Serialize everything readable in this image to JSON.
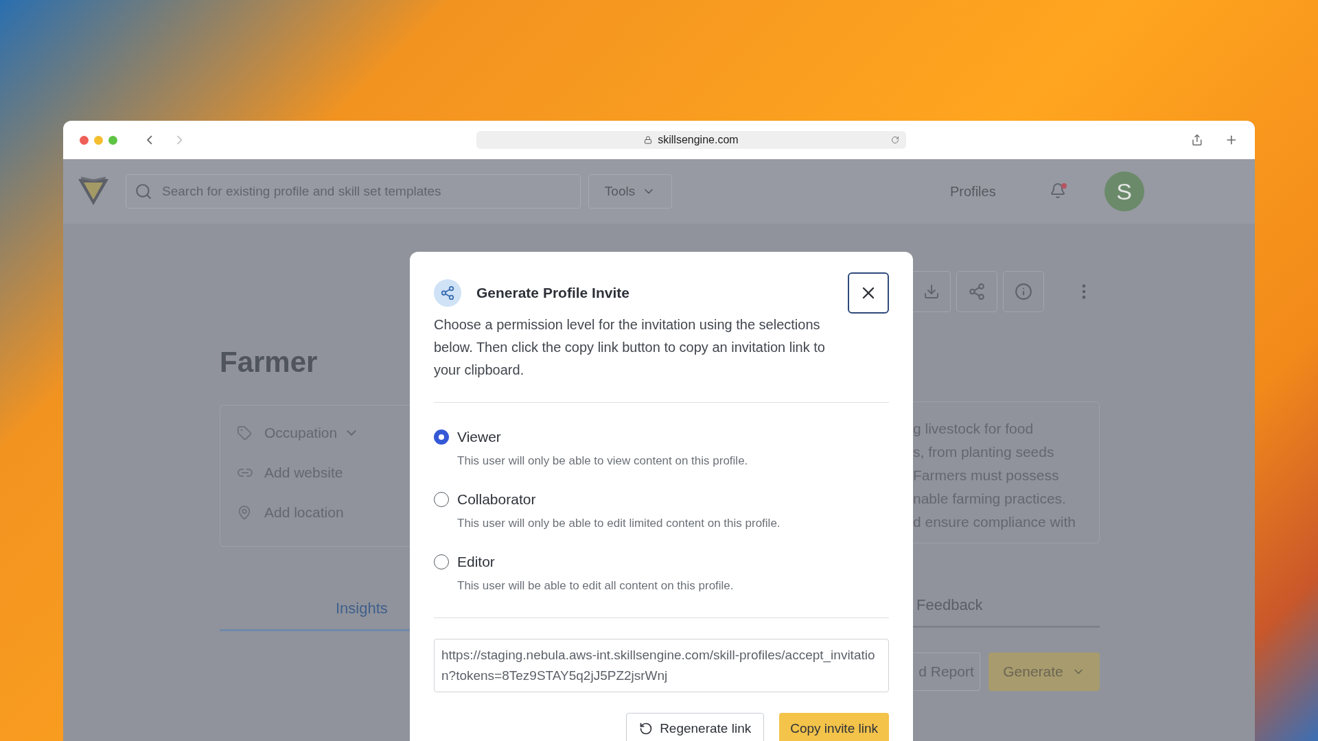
{
  "browser": {
    "url": "skillsengine.com"
  },
  "header": {
    "search": {
      "placeholder": "Search for existing profile and skill set templates"
    },
    "tools": "Tools",
    "nav": "Profiles",
    "avatar": "S"
  },
  "profile": {
    "title": "Farmer",
    "details": [
      {
        "kind": "tag",
        "label": "Occupation"
      },
      {
        "kind": "link",
        "label": "Add website"
      },
      {
        "kind": "location",
        "label": "Add location"
      }
    ],
    "description_lines": [
      "g livestock for food",
      "s, from planting seeds",
      "Farmers must possess",
      "nable farming practices.",
      "d ensure compliance with"
    ],
    "tabs": [
      {
        "label": "Insights",
        "selected": true
      },
      {
        "label": "Feedback",
        "selected": false
      }
    ],
    "actions": [
      {
        "kind": "outline",
        "label": "d Report"
      },
      {
        "kind": "dropdown",
        "label": "Generate"
      }
    ]
  },
  "modal": {
    "title": "Generate Profile Invite",
    "description": "Choose a permission level for the invitation using the selections below. Then click the copy link button to copy an invitation link to your clipboard.",
    "options": [
      {
        "label": "Viewer",
        "description": "This user will only be able to view content on this profile.",
        "selected": true
      },
      {
        "label": "Collaborator",
        "description": "This user will only be able to edit limited content on this profile.",
        "selected": false
      },
      {
        "label": "Editor",
        "description": "This user will be able to edit all content on this profile.",
        "selected": false
      }
    ],
    "link": "https://staging.nebula.aws-int.skillsengine.com/skill-profiles/accept_invitation?tokens=8Tez9STAY5q2jJ5PZ2jsrWnj",
    "buttons": [
      {
        "kind": "secondary",
        "label": "Regenerate link"
      },
      {
        "kind": "primary",
        "label": "Copy invite link"
      }
    ]
  }
}
